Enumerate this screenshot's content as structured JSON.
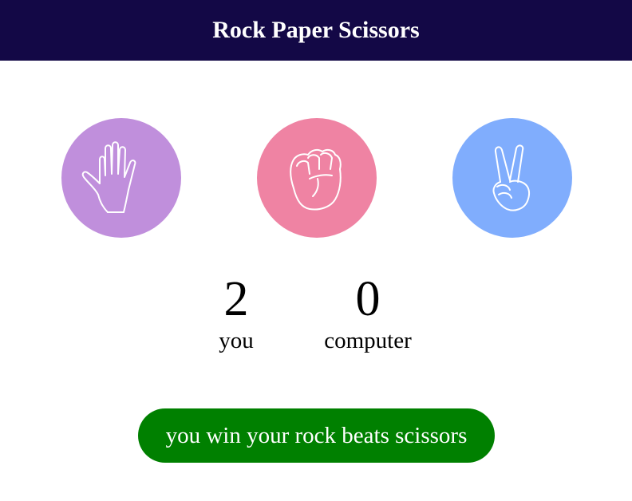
{
  "header": {
    "title": "Rock Paper Scissors",
    "background": "#130846"
  },
  "choices": [
    {
      "name": "paper",
      "icon": "open-hand-icon",
      "color": "#c08fdc"
    },
    {
      "name": "rock",
      "icon": "fist-icon",
      "color": "#ef83a3"
    },
    {
      "name": "scissors",
      "icon": "victory-hand-icon",
      "color": "#80adfd"
    }
  ],
  "score": {
    "you": {
      "value": "2",
      "label": "you"
    },
    "computer": {
      "value": "0",
      "label": "computer"
    }
  },
  "result": {
    "message": "you win your rock beats scissors",
    "color": "#008000"
  }
}
